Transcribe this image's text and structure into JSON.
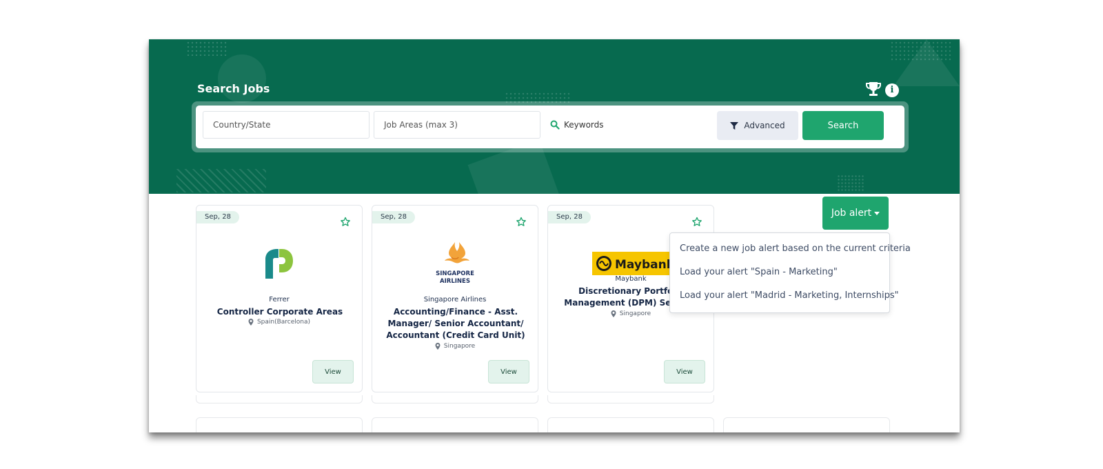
{
  "hero": {
    "title": "Search Jobs",
    "info_glyph": "i"
  },
  "search": {
    "country_placeholder": "Country/State",
    "job_areas_placeholder": "Job Areas (max 3)",
    "keywords_placeholder": "Keywords",
    "advanced_label": "Advanced",
    "search_label": "Search"
  },
  "job_alert": {
    "label": "Job alert",
    "menu": [
      {
        "label": "Create a new job alert based on the current criteria"
      },
      {
        "label": "Load your alert \"Spain - Marketing\""
      },
      {
        "label": "Load your alert \"Madrid - Marketing, Internships\""
      }
    ]
  },
  "jobs": [
    {
      "date": "Sep, 28",
      "company": "Ferrer",
      "title": "Controller Corporate Areas",
      "location": "Spain(Barcelona)",
      "view_label": "View",
      "logo": "ferrer-logo"
    },
    {
      "date": "Sep, 28",
      "company": "Singapore Airlines",
      "title": "Accounting/Finance - Asst. Manager/ Senior Accountant/ Accountant (Credit Card Unit)",
      "location": "Singapore",
      "view_label": "View",
      "logo": "singapore-airlines-logo",
      "logo_text": [
        "SINGAPORE",
        "AIRLINES"
      ]
    },
    {
      "date": "Sep, 28",
      "company": "Maybank",
      "title": "Discretionary Portfolio Management (DPM) Services",
      "location": "Singapore",
      "view_label": "View",
      "logo": "maybank-logo",
      "logo_text": "Maybank"
    }
  ],
  "colors": {
    "hero_green": "#076a4f",
    "accent_green": "#1fa56e",
    "badge_bg": "#e3f3ec",
    "maybank_yellow": "#f6c500"
  },
  "icons": [
    "trophy-icon",
    "info-icon",
    "search-icon",
    "filter-icon",
    "star-icon",
    "pin-icon",
    "caret-down-icon"
  ]
}
